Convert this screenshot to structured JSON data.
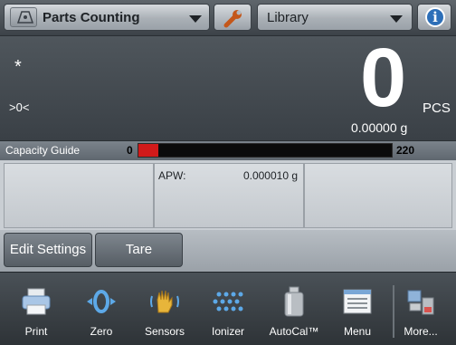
{
  "header": {
    "app_mode": "Parts Counting",
    "library_label": "Library",
    "info_symbol": "i"
  },
  "display": {
    "stable_indicator": "*",
    "zero_indicator": ">0<",
    "main_value": "0",
    "main_unit": "PCS",
    "weight_readout": "0.00000 g"
  },
  "capacity_guide": {
    "label": "Capacity Guide",
    "min": "0",
    "max": "220",
    "fill_fraction": 0.08,
    "fill_color": "#d11a1a"
  },
  "info": {
    "apw_label": "APW:",
    "apw_value": "0.000010 g"
  },
  "actions": {
    "edit_settings": "Edit Settings",
    "tare": "Tare"
  },
  "nav": [
    {
      "label": "Print",
      "icon": "printer-icon"
    },
    {
      "label": "Zero",
      "icon": "zero-icon"
    },
    {
      "label": "Sensors",
      "icon": "hand-sensor-icon"
    },
    {
      "label": "Ionizer",
      "icon": "ionizer-icon"
    },
    {
      "label": "AutoCal™",
      "icon": "calibration-weight-icon"
    },
    {
      "label": "Menu",
      "icon": "menu-icon"
    },
    {
      "label": "More...",
      "icon": "more-icon"
    }
  ],
  "colors": {
    "accent_blue": "#2d6fb8",
    "capacity_fill": "#d11a1a"
  }
}
